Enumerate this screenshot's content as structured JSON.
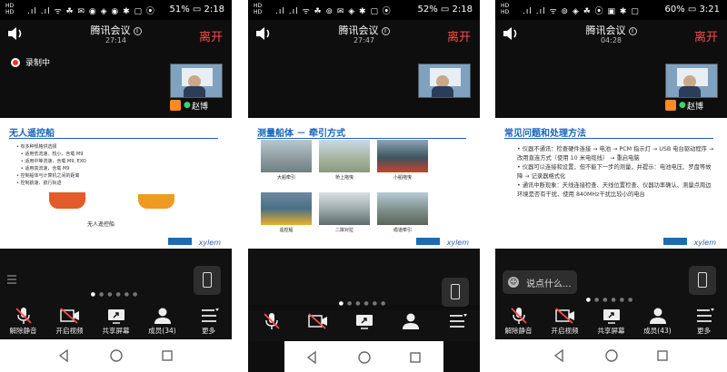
{
  "screens": [
    {
      "status": {
        "sim1": "HD",
        "sim2": "HD",
        "battery": "51%",
        "time": "2:18"
      },
      "app_title": "腾讯会议",
      "duration": "27:14",
      "leave_label": "离开",
      "recording_label": "录制中",
      "participant_name": "赵博",
      "slide": {
        "title": "无人遥控船",
        "bullets": [
          "有多种规格供选择",
          "适用低流速、较小，含载 M9",
          "适用中等流速，含载 M9, EXO",
          "适用高流速，含载 M9",
          "控制船体与计算机之间的距离",
          "控制航速、航行轨迹"
        ],
        "caption": "无人遥控船"
      },
      "toolbar": {
        "mute": "解除静音",
        "video": "开启视频",
        "share": "共享屏幕",
        "members": "成员(34)",
        "more": "更多"
      }
    },
    {
      "status": {
        "sim1": "HD",
        "sim2": "HD",
        "battery": "52%",
        "time": "2:18"
      },
      "app_title": "腾讯会议",
      "duration": "27:47",
      "leave_label": "离开",
      "slide": {
        "title": "测量船体  －  牵引方式",
        "captions": [
          "大船牵引",
          "桥上拖曳",
          "小船拖曳",
          "遥控船",
          "二岸对拉",
          "缆道牵引"
        ]
      }
    },
    {
      "status": {
        "sim1": "HD",
        "sim2": "HD",
        "battery": "60%",
        "time": "3:21"
      },
      "app_title": "腾讯会议",
      "duration": "04:28",
      "leave_label": "离开",
      "participant_name": "赵博",
      "slide": {
        "title": "常见问题和处理方法",
        "bullets": [
          "仪器不通讯：检查硬件连接 → 电池 → PCM 指示灯 → USB 电台驱动程序 → 改用直连方式（使用 10 米电缆线） → 重启电脑",
          "仪器可以连接和设置，但不能下一步的测量，并提示：电池电压、罗盘等故障 → 记录器格式化",
          "通讯中断现象：天线连接检查、天线位置检查、仪器功率确认、测量点周边环境是否有干扰、使用 840MHz干扰比较小的电台"
        ]
      },
      "chat_placeholder": "说点什么...",
      "toolbar": {
        "mute": "解除静音",
        "video": "开启视频",
        "share": "共享屏幕",
        "members": "成员(43)",
        "more": "更多"
      }
    }
  ],
  "colors": {
    "leave": "#ff4a4a",
    "slide_title": "#1a63b8",
    "recording_dot": "#e32222"
  },
  "icons": [
    "speaker-icon",
    "info-icon",
    "record-icon",
    "mic-muted-icon",
    "video-off-icon",
    "share-screen-icon",
    "members-icon",
    "more-icon",
    "back-icon",
    "home-icon",
    "recents-icon",
    "phone-screen-icon",
    "list-icon",
    "smile-icon"
  ]
}
